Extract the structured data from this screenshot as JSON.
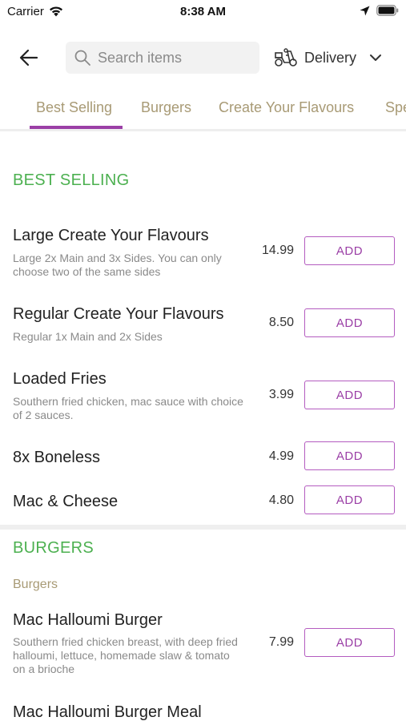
{
  "status_bar": {
    "carrier": "Carrier",
    "time": "8:38 AM"
  },
  "header": {
    "search_placeholder": "Search items",
    "delivery_label": "Delivery"
  },
  "tabs": [
    {
      "label": "Best Selling",
      "active": true
    },
    {
      "label": "Burgers",
      "active": false
    },
    {
      "label": "Create Your Flavours",
      "active": false
    },
    {
      "label": "Spe",
      "active": false
    }
  ],
  "colors": {
    "accent_purple": "#9b3fa6",
    "section_green": "#4cb050",
    "tab_text": "#a89a75"
  },
  "sections": [
    {
      "title": "BEST SELLING",
      "items": [
        {
          "name": "Large Create Your Flavours",
          "description": "Large 2x Main and 3x Sides. You can only choose two of the same sides",
          "price": "14.99",
          "button": "ADD"
        },
        {
          "name": "Regular Create Your Flavours",
          "description": "Regular 1x Main and 2x Sides",
          "price": "8.50",
          "button": "ADD"
        },
        {
          "name": "Loaded Fries",
          "description": "Southern fried chicken, mac sauce with choice of 2 sauces.",
          "price": "3.99",
          "button": "ADD"
        },
        {
          "name": "8x Boneless",
          "description": "",
          "price": "4.99",
          "button": "ADD"
        },
        {
          "name": "Mac & Cheese",
          "description": "",
          "price": "4.80",
          "button": "ADD"
        }
      ]
    },
    {
      "title": "BURGERS",
      "subcategory": "Burgers",
      "items": [
        {
          "name": "Mac Halloumi Burger",
          "description": "Southern fried chicken breast, with deep fried halloumi, lettuce, homemade slaw & tomato on a brioche",
          "price": "7.99",
          "button": "ADD"
        },
        {
          "name": "Mac Halloumi Burger Meal",
          "description": "",
          "price": "",
          "button": ""
        }
      ]
    }
  ]
}
